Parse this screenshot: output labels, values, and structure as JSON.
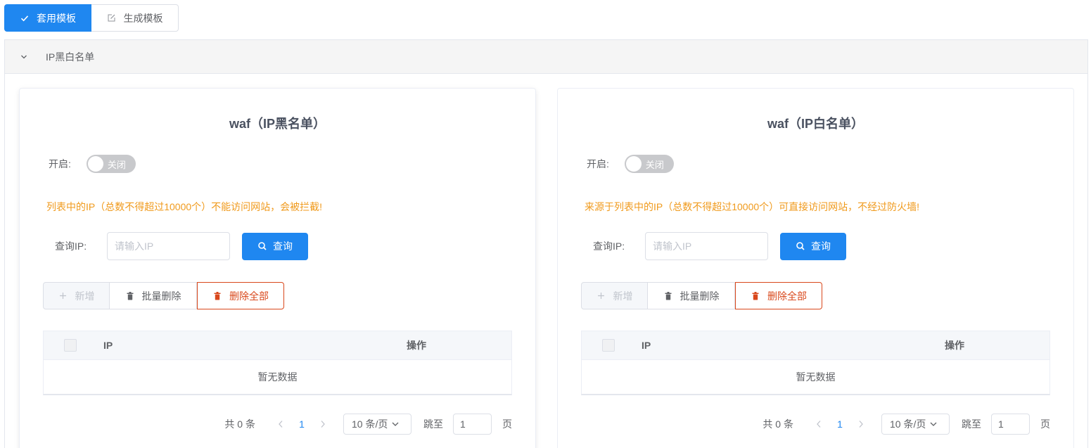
{
  "tabs": {
    "active_label": "套用模板",
    "other_label": "生成模板"
  },
  "section": {
    "title": "IP黑白名单"
  },
  "blacklist": {
    "title": "waf（IP黑名单）",
    "switch_label": "开启:",
    "switch_state": "关闭",
    "notice": "列表中的IP（总数不得超过10000个）不能访问网站，会被拦截!",
    "query_label": "查询IP:",
    "query_placeholder": "请输入IP",
    "query_button": "查询",
    "add_button": "新增",
    "batch_delete_button": "批量删除",
    "delete_all_button": "删除全部",
    "columns": [
      "IP",
      "操作"
    ],
    "empty_text": "暂无数据",
    "pager": {
      "total": "共 0 条",
      "current_page": "1",
      "page_size": "10 条/页",
      "jump_label": "跳至",
      "jump_value": "1",
      "unit": "页"
    }
  },
  "whitelist": {
    "title": "waf（IP白名单）",
    "switch_label": "开启:",
    "switch_state": "关闭",
    "notice": "来源于列表中的IP（总数不得超过10000个）可直接访问网站，不经过防火墙!",
    "query_label": "查询IP:",
    "query_placeholder": "请输入IP",
    "query_button": "查询",
    "add_button": "新增",
    "batch_delete_button": "批量删除",
    "delete_all_button": "删除全部",
    "columns": [
      "IP",
      "操作"
    ],
    "empty_text": "暂无数据",
    "pager": {
      "total": "共 0 条",
      "current_page": "1",
      "page_size": "10 条/页",
      "jump_label": "跳至",
      "jump_value": "1",
      "unit": "页"
    }
  },
  "colors": {
    "primary": "#1f87f0",
    "warning_text": "#f09a1c",
    "danger": "#d9481c"
  }
}
